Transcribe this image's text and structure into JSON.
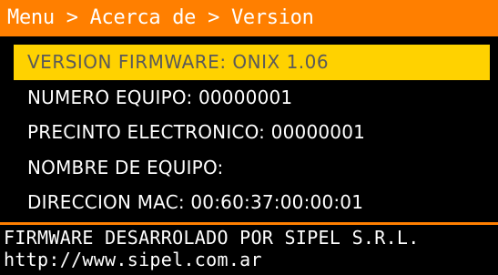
{
  "breadcrumb": "Menu > Acerca de > Version",
  "items": [
    {
      "label": "VERSION FIRMWARE: ONIX 1.06",
      "selected": true
    },
    {
      "label": "NUMERO EQUIPO: 00000001",
      "selected": false
    },
    {
      "label": "PRECINTO ELECTRONICO: 00000001",
      "selected": false
    },
    {
      "label": "NOMBRE DE EQUIPO:",
      "selected": false
    },
    {
      "label": "DIRECCION MAC: 00:60:37:00:00:01",
      "selected": false
    }
  ],
  "footer": {
    "line1": "FIRMWARE DESARROLADO POR SIPEL S.R.L.",
    "line2": "http://www.sipel.com.ar"
  },
  "colors": {
    "accent": "#ff7f00",
    "selection": "#ffd200",
    "background": "#000000",
    "text": "#ffffff"
  }
}
